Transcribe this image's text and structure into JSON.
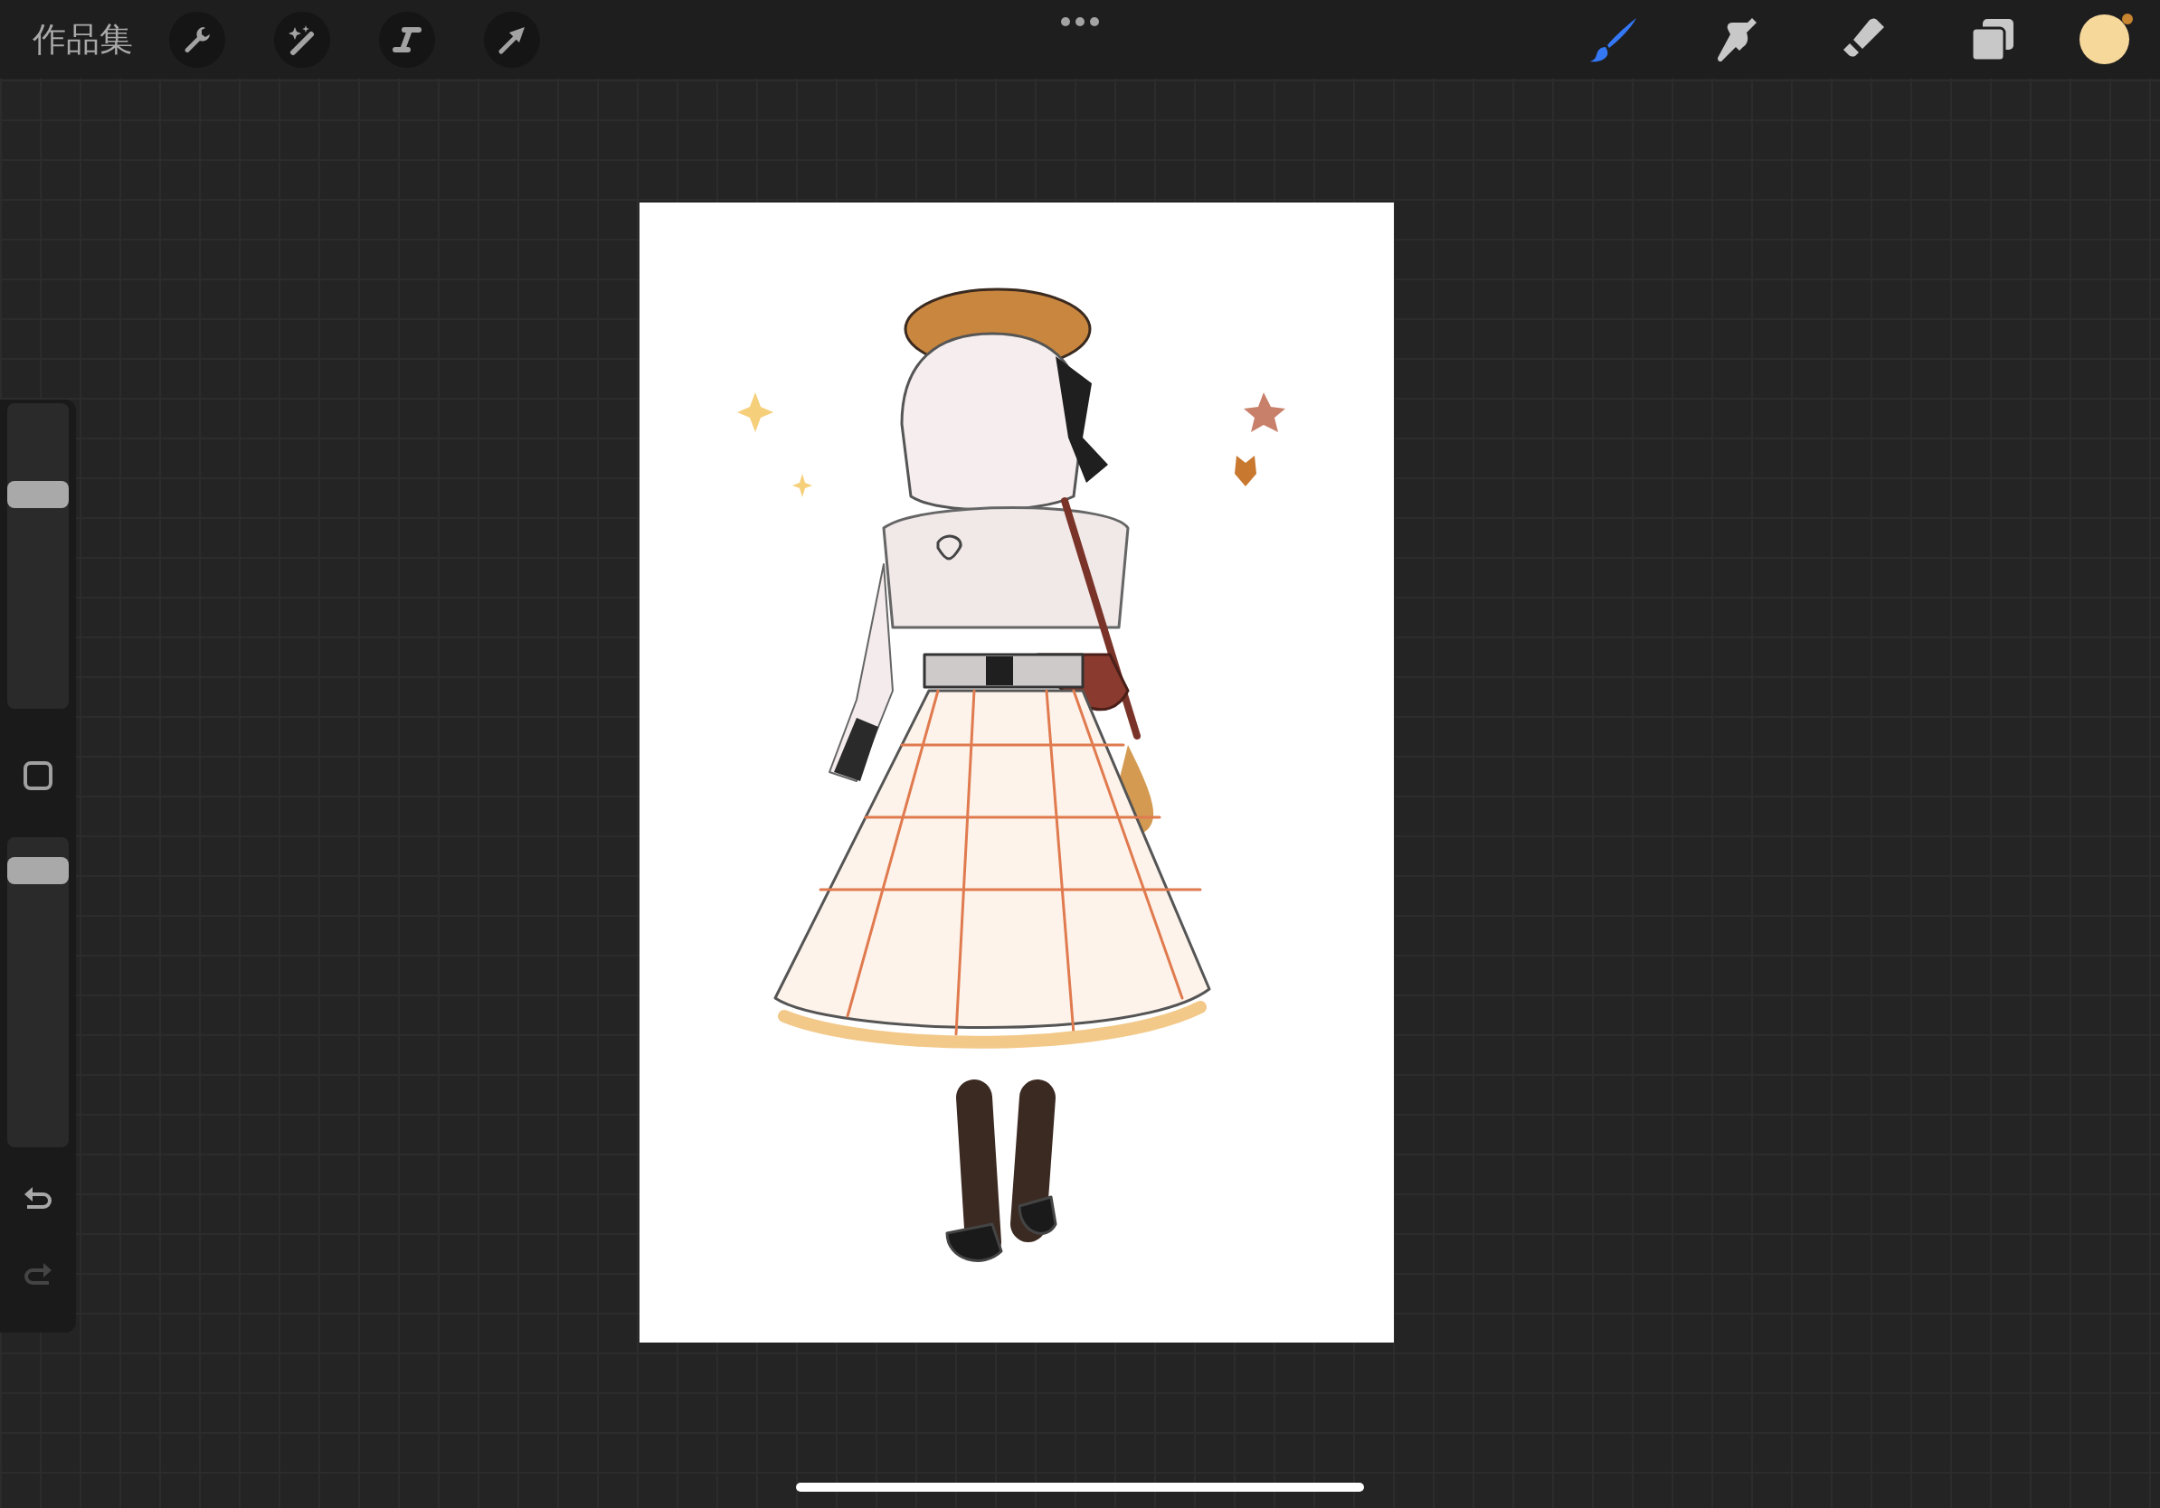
{
  "top_bar": {
    "gallery_label": "作品集"
  },
  "tools": [
    {
      "selected": true
    },
    {
      "selected": false
    },
    {
      "selected": false
    },
    {
      "selected": false
    }
  ],
  "color_swatch": {
    "color": "#f7d89b"
  },
  "sidebar": {
    "brush_size": {
      "level": 0.72
    },
    "opacity": {
      "level": 0.93
    },
    "undo": {
      "disabled": false
    },
    "redo": {
      "disabled": true
    }
  }
}
